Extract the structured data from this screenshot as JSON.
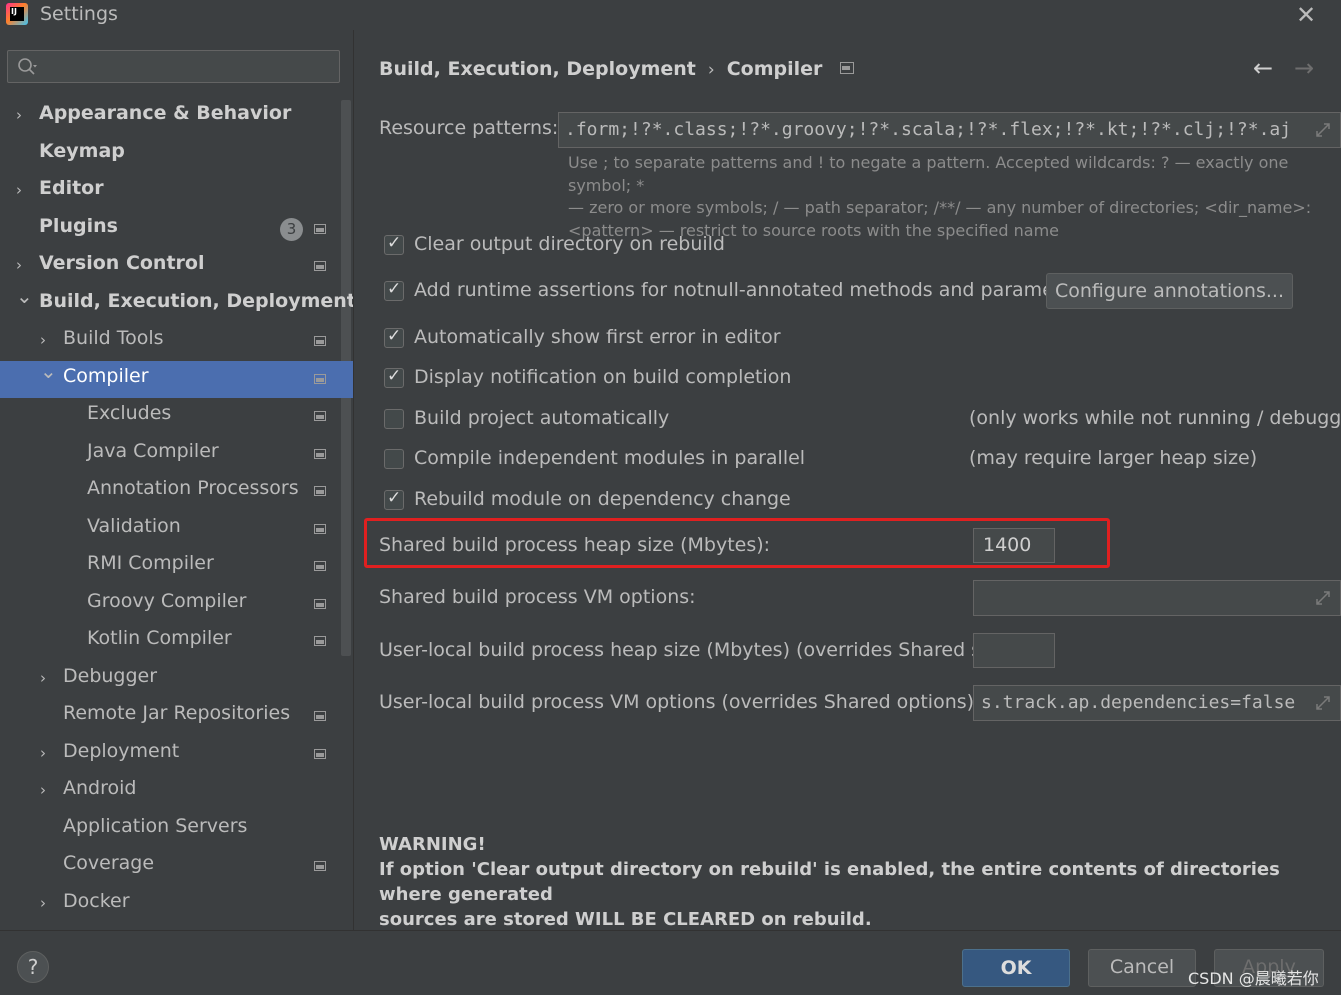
{
  "window": {
    "title": "Settings",
    "app_icon_text": "IJ"
  },
  "sidebar": {
    "search_placeholder": "",
    "items": [
      {
        "label": "Appearance & Behavior",
        "bold": true,
        "expandable": true,
        "expanded": false,
        "level": 0
      },
      {
        "label": "Keymap",
        "bold": true,
        "expandable": false,
        "level": 0
      },
      {
        "label": "Editor",
        "bold": true,
        "expandable": true,
        "expanded": false,
        "level": 0
      },
      {
        "label": "Plugins",
        "bold": true,
        "expandable": false,
        "level": 0,
        "badge": "3"
      },
      {
        "label": "Version Control",
        "bold": true,
        "expandable": true,
        "expanded": false,
        "level": 0
      },
      {
        "label": "Build, Execution, Deployment",
        "bold": true,
        "expandable": true,
        "expanded": true,
        "level": 0
      },
      {
        "label": "Build Tools",
        "expandable": true,
        "expanded": false,
        "level": 1
      },
      {
        "label": "Compiler",
        "expandable": true,
        "expanded": true,
        "level": 1,
        "selected": true
      },
      {
        "label": "Excludes",
        "level": 2
      },
      {
        "label": "Java Compiler",
        "level": 2
      },
      {
        "label": "Annotation Processors",
        "level": 2
      },
      {
        "label": "Validation",
        "level": 2
      },
      {
        "label": "RMI Compiler",
        "level": 2
      },
      {
        "label": "Groovy Compiler",
        "level": 2
      },
      {
        "label": "Kotlin Compiler",
        "level": 2
      },
      {
        "label": "Debugger",
        "expandable": true,
        "expanded": false,
        "level": 1
      },
      {
        "label": "Remote Jar Repositories",
        "level": 1
      },
      {
        "label": "Deployment",
        "expandable": true,
        "expanded": false,
        "level": 1
      },
      {
        "label": "Android",
        "expandable": true,
        "expanded": false,
        "level": 1
      },
      {
        "label": "Application Servers",
        "level": 1
      },
      {
        "label": "Coverage",
        "level": 1
      },
      {
        "label": "Docker",
        "expandable": true,
        "expanded": false,
        "level": 1
      }
    ]
  },
  "breadcrumb": {
    "parent": "Build, Execution, Deployment",
    "current": "Compiler",
    "separator": "›"
  },
  "compiler": {
    "resource_patterns_label": "Resource patterns:",
    "resource_patterns_value": ".form;!?*.class;!?*.groovy;!?*.scala;!?*.flex;!?*.kt;!?*.clj;!?*.aj",
    "hint_line1": "Use ; to separate patterns and ! to negate a pattern. Accepted wildcards: ? — exactly one symbol; *",
    "hint_line2": "— zero or more symbols; / — path separator; /**/ — any number of directories; <dir_name>:",
    "hint_line3": "<pattern> — restrict to source roots with the specified name",
    "options": [
      {
        "label": "Clear output directory on rebuild",
        "checked": true
      },
      {
        "label": "Add runtime assertions for notnull-annotated methods and parameters",
        "checked": true
      },
      {
        "label": "Automatically show first error in editor",
        "checked": true
      },
      {
        "label": "Display notification on build completion",
        "checked": true
      },
      {
        "label": "Build project automatically",
        "checked": false,
        "note": "(only works while not running / debugging)"
      },
      {
        "label": "Compile independent modules in parallel",
        "checked": false,
        "note": "(may require larger heap size)"
      },
      {
        "label": "Rebuild module on dependency change",
        "checked": true
      }
    ],
    "configure_annotations_button": "Configure annotations...",
    "shared_heap_label": "Shared build process heap size (Mbytes):",
    "shared_heap_value": "1400",
    "shared_vm_label": "Shared build process VM options:",
    "shared_vm_value": "",
    "user_heap_label": "User-local build process heap size (Mbytes) (overrides Shared size):",
    "user_heap_value": "",
    "user_vm_label": "User-local build process VM options (overrides Shared options):",
    "user_vm_value": "s.track.ap.dependencies=false",
    "warning_title": "WARNING!",
    "warning_text_line1": "If option 'Clear output directory on rebuild' is enabled, the entire contents of directories where generated",
    "warning_text_line2": "sources are stored WILL BE CLEARED on rebuild."
  },
  "footer": {
    "help": "?",
    "ok": "OK",
    "cancel": "Cancel",
    "apply": "Apply",
    "watermark": "CSDN @晨曦若你"
  },
  "colors": {
    "background": "#3c3f41",
    "selection": "#4b6eaf",
    "ok_button": "#365880",
    "highlight_box": "#e02020"
  }
}
